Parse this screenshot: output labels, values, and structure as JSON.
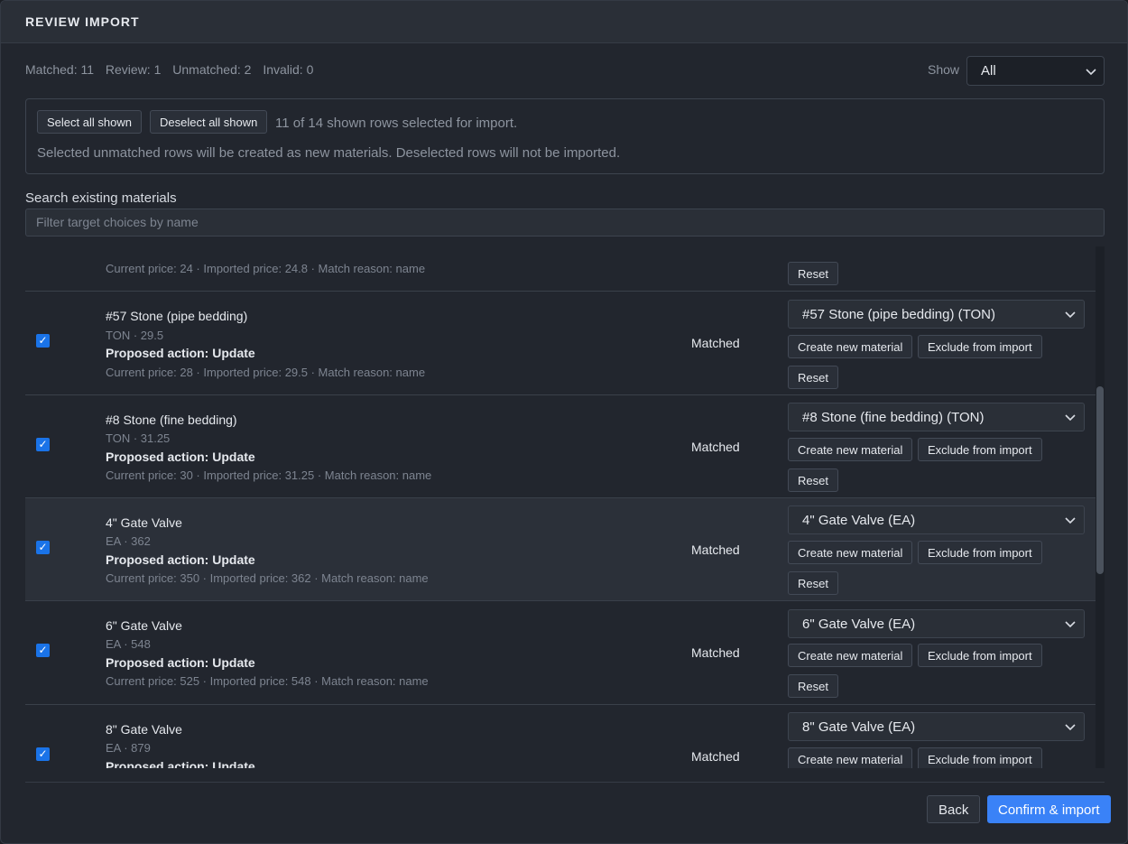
{
  "title": "REVIEW IMPORT",
  "summary": {
    "matched": "Matched: 11",
    "review": "Review: 1",
    "unmatched": "Unmatched: 2",
    "invalid": "Invalid: 0"
  },
  "filter": {
    "label": "Show",
    "value": "All"
  },
  "selection": {
    "select_all": "Select all shown",
    "deselect_all": "Deselect all shown",
    "count_text": "11 of 14 shown rows selected for import.",
    "note": "Selected unmatched rows will be created as new materials. Deselected rows will not be imported."
  },
  "search": {
    "label": "Search existing materials",
    "placeholder": "Filter target choices by name"
  },
  "row_buttons": {
    "create": "Create new material",
    "exclude": "Exclude from import",
    "reset": "Reset"
  },
  "partial_row": {
    "reason": "Current price: 24 · Imported price: 24.8 · Match reason: name"
  },
  "rows": [
    {
      "checked": true,
      "name": "#57 Stone (pipe bedding)",
      "meta": "TON · 29.5",
      "action": "Proposed action: Update",
      "reason": "Current price: 28 · Imported price: 29.5 · Match reason: name",
      "status": "Matched",
      "target": "#57 Stone (pipe bedding) (TON)"
    },
    {
      "checked": true,
      "name": "#8 Stone (fine bedding)",
      "meta": "TON · 31.25",
      "action": "Proposed action: Update",
      "reason": "Current price: 30 · Imported price: 31.25 · Match reason: name",
      "status": "Matched",
      "target": "#8 Stone (fine bedding) (TON)"
    },
    {
      "checked": true,
      "name": "4\" Gate Valve",
      "meta": "EA · 362",
      "action": "Proposed action: Update",
      "reason": "Current price: 350 · Imported price: 362 · Match reason: name",
      "status": "Matched",
      "target": "4\" Gate Valve (EA)"
    },
    {
      "checked": true,
      "name": "6\" Gate Valve",
      "meta": "EA · 548",
      "action": "Proposed action: Update",
      "reason": "Current price: 525 · Imported price: 548 · Match reason: name",
      "status": "Matched",
      "target": "6\" Gate Valve (EA)"
    },
    {
      "checked": true,
      "name": "8\" Gate Valve",
      "meta": "EA · 879",
      "action": "Proposed action: Update",
      "status": "Matched",
      "target": "8\" Gate Valve (EA)"
    }
  ],
  "footer": {
    "back": "Back",
    "confirm": "Confirm & import"
  }
}
